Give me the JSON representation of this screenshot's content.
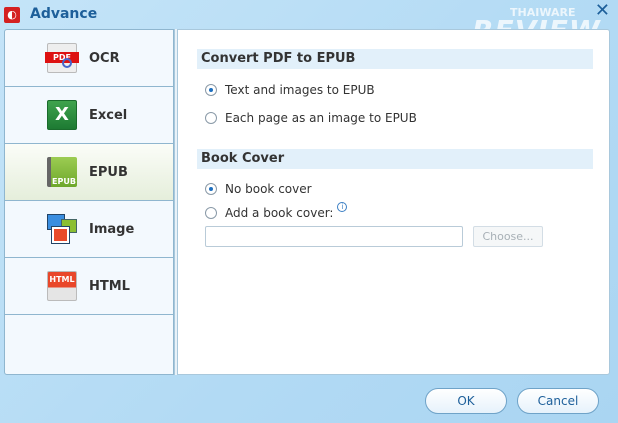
{
  "window": {
    "title": "Advance",
    "close": "✕",
    "watermark_top": "THAIWARE",
    "watermark_main": "REVIEW"
  },
  "sidebar": {
    "items": [
      {
        "label": "OCR",
        "icon": "pdf-ocr-icon",
        "icon_text": "PDF"
      },
      {
        "label": "Excel",
        "icon": "excel-icon",
        "icon_text": "X"
      },
      {
        "label": "EPUB",
        "icon": "epub-icon",
        "icon_text": "EPUB"
      },
      {
        "label": "Image",
        "icon": "image-icon",
        "icon_text": ""
      },
      {
        "label": "HTML",
        "icon": "html-icon",
        "icon_text": "HTML"
      }
    ],
    "selected": "EPUB"
  },
  "main": {
    "convert_header": "Convert PDF to EPUB",
    "convert_options": [
      {
        "label": "Text and images to EPUB",
        "checked": true
      },
      {
        "label": "Each page as an image to EPUB",
        "checked": false
      }
    ],
    "cover_header": "Book Cover",
    "cover_options": [
      {
        "label": "No book cover",
        "checked": true
      },
      {
        "label": "Add a book cover:",
        "checked": false
      }
    ],
    "cover_path": "",
    "choose_label": "Choose..."
  },
  "footer": {
    "ok": "OK",
    "cancel": "Cancel"
  }
}
